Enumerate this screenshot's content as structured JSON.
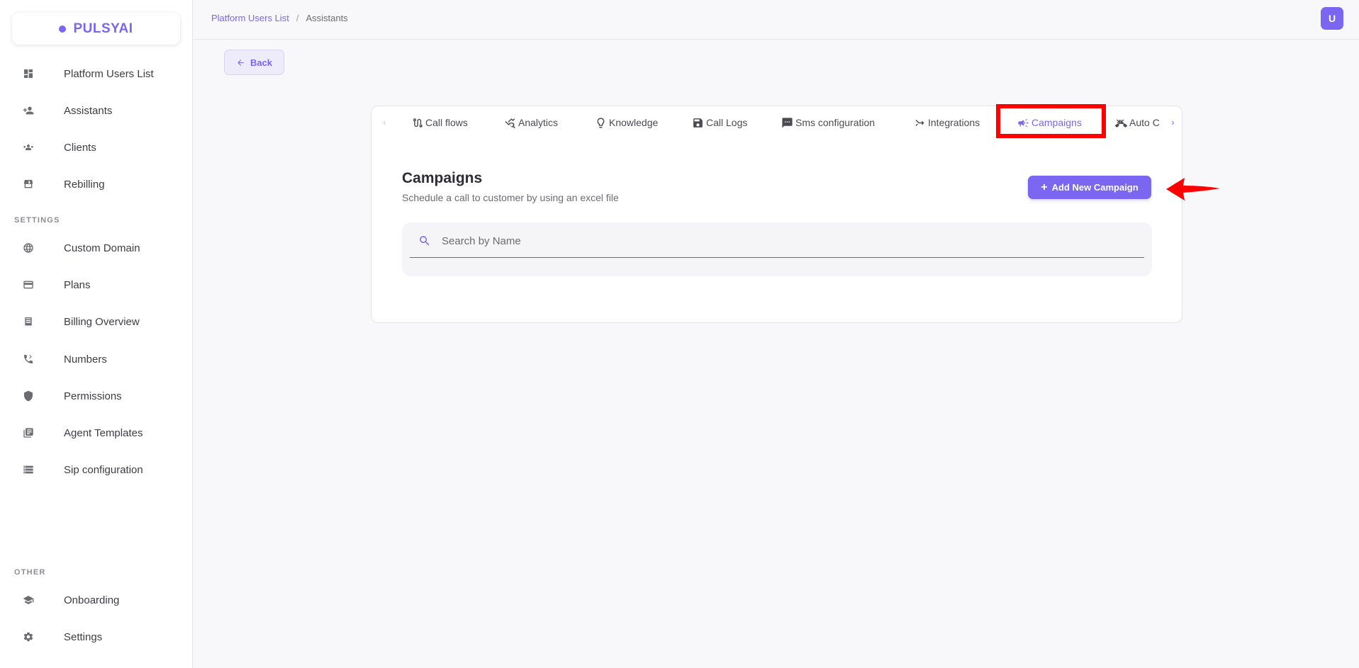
{
  "brand": {
    "name": "PULSYAI"
  },
  "sidebar": {
    "items": [
      {
        "label": "Platform Users List",
        "icon": "dashboard-icon"
      },
      {
        "label": "Assistants",
        "icon": "person-add-icon"
      },
      {
        "label": "Clients",
        "icon": "group-icon"
      },
      {
        "label": "Rebilling",
        "icon": "storefront-icon"
      }
    ],
    "settings_label": "SETTINGS",
    "settings_items": [
      {
        "label": "Custom Domain",
        "icon": "globe-icon"
      },
      {
        "label": "Plans",
        "icon": "credit-card-icon"
      },
      {
        "label": "Billing Overview",
        "icon": "receipt-icon"
      },
      {
        "label": "Numbers",
        "icon": "phone-icon"
      },
      {
        "label": "Permissions",
        "icon": "shield-icon"
      },
      {
        "label": "Agent Templates",
        "icon": "library-icon"
      },
      {
        "label": "Sip configuration",
        "icon": "storage-icon"
      }
    ],
    "other_label": "OTHER",
    "other_items": [
      {
        "label": "Onboarding",
        "icon": "school-icon"
      },
      {
        "label": "Settings",
        "icon": "gear-icon"
      }
    ]
  },
  "breadcrumb": {
    "root": "Platform Users List",
    "separator": "/",
    "current": "Assistants"
  },
  "user": {
    "avatar_letter": "U"
  },
  "back_label": "Back",
  "tabs": [
    {
      "label": "Call flows",
      "icon": "call-flow-icon"
    },
    {
      "label": "Analytics",
      "icon": "analytics-icon"
    },
    {
      "label": "Knowledge",
      "icon": "lightbulb-icon"
    },
    {
      "label": "Call Logs",
      "icon": "save-icon"
    },
    {
      "label": "Sms configuration",
      "icon": "sms-icon"
    },
    {
      "label": "Integrations",
      "icon": "merge-icon"
    },
    {
      "label": "Campaigns",
      "icon": "campaign-icon",
      "active": true
    },
    {
      "label": "Auto C",
      "icon": "auto-call-icon"
    }
  ],
  "campaigns": {
    "title": "Campaigns",
    "subtitle": "Schedule a call to customer by using an excel file",
    "add_label": "Add New Campaign",
    "add_icon": "+",
    "search_placeholder": "Search by Name"
  },
  "colors": {
    "accent": "#7a66f0",
    "annotation": "#ff0000"
  }
}
